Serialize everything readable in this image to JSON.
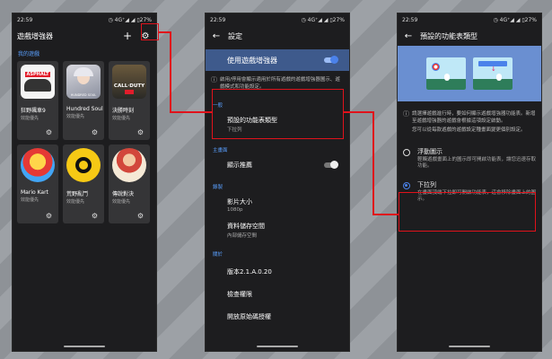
{
  "status": {
    "time": "22:59",
    "right": "◷ 4G⁺◢ ◢ ▯27%"
  },
  "phone1": {
    "title": "遊戲增強器",
    "add": "+",
    "section": "我的遊戲",
    "games": [
      {
        "name": "狂野飆車9",
        "sub": "效能優先",
        "logo_text": "ASPHALT"
      },
      {
        "name": "Hundred Soul",
        "sub": "效能優先",
        "logo_text": "HUNDRED SOUL"
      },
      {
        "name": "決勝時刻",
        "sub": "效能優先",
        "logo_text": "CALL·DUTY"
      },
      {
        "name": "Mario Kart",
        "sub": "效能優先",
        "logo_text": ""
      },
      {
        "name": "荒野亂鬥",
        "sub": "效能優先",
        "logo_text": ""
      },
      {
        "name": "傳說對決",
        "sub": "效能優先",
        "logo_text": ""
      }
    ]
  },
  "phone2": {
    "title": "設定",
    "toggle_label": "使用遊戲增強器",
    "info": "啟用/停用會顯示適用於所有遊戲的遊戲增強器圖示、遊戲模式和功能設定。",
    "cat_general": "一般",
    "default_menu": "預設的功能表類型",
    "default_menu_sub": "下拉列",
    "cat_theme": "主畫面",
    "show_recommend": "顯示推薦",
    "cat_record": "錄製",
    "video_size": "影片大小",
    "video_size_sub": "1080p",
    "storage": "資料儲存空間",
    "storage_sub": "內部儲存空間",
    "cat_about": "關於",
    "version": "版本2.1.A.0.20",
    "permissions": "檢查權限",
    "license": "開放原始碼授權"
  },
  "phone3": {
    "title": "預設的功能表類型",
    "info1": "請選擇遊戲進行時，要如何顯示遊戲增強器功能表。新增至遊戲增強器的遊戲會根據這項設定啟動。",
    "info2": "您可以從每款遊戲的遊戲設定種畫面變更個別設定。",
    "opt1": "浮動圖示",
    "opt1_sub": "輕觸遊戲畫面上的圖示即可開啟功能表，讓您迅速存取功能。",
    "opt2": "下拉列",
    "opt2_sub": "在畫面頂端下拉即可開啟功能表，這會移除畫面上的圖示。"
  },
  "colors": {
    "accent": "#4b82ea",
    "highlight": "#e0121b"
  }
}
